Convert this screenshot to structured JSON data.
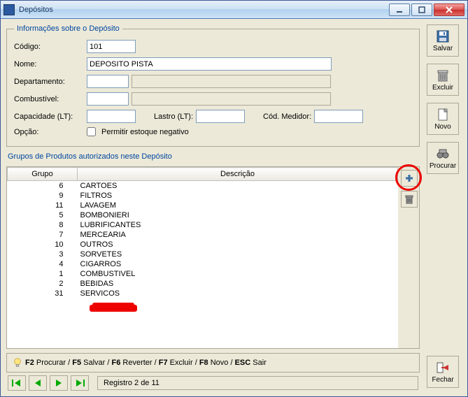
{
  "window": {
    "title": "Depósitos"
  },
  "info": {
    "legend": "Informações sobre o Depósito",
    "codigo_label": "Código:",
    "codigo_value": "101",
    "nome_label": "Nome:",
    "nome_value": "DEPOSITO PISTA",
    "dep_label": "Departamento:",
    "comb_label": "Combustível:",
    "cap_label": "Capacidade (LT):",
    "lastro_label": "Lastro (LT):",
    "medidor_label": "Cód. Medidor:",
    "opcao_label": "Opção:",
    "permitir_label": "Permitir estoque negativo"
  },
  "groups": {
    "title": "Grupos de Produtos autorizados neste Depósito",
    "col_grupo": "Grupo",
    "col_desc": "Descrição",
    "rows": [
      {
        "g": "6",
        "d": "CARTOES"
      },
      {
        "g": "9",
        "d": "FILTROS"
      },
      {
        "g": "11",
        "d": "LAVAGEM"
      },
      {
        "g": "5",
        "d": "BOMBONIERI"
      },
      {
        "g": "8",
        "d": "LUBRIFICANTES"
      },
      {
        "g": "7",
        "d": "MERCEARIA"
      },
      {
        "g": "10",
        "d": "OUTROS"
      },
      {
        "g": "3",
        "d": "SORVETES"
      },
      {
        "g": "4",
        "d": "CIGARROS"
      },
      {
        "g": "1",
        "d": "COMBUSTIVEL"
      },
      {
        "g": "2",
        "d": "BEBIDAS"
      },
      {
        "g": "31",
        "d": "SERVICOS"
      }
    ]
  },
  "side": {
    "salvar": "Salvar",
    "excluir": "Excluir",
    "novo": "Novo",
    "procurar": "Procurar",
    "fechar": "Fechar"
  },
  "status": {
    "f2": "F2",
    "f2t": " Procurar / ",
    "f5": "F5",
    "f5t": " Salvar / ",
    "f6": "F6",
    "f6t": " Reverter / ",
    "f7": "F7",
    "f7t": " Excluir / ",
    "f8": "F8",
    "f8t": " Novo / ",
    "esc": "ESC",
    "esct": " Sair"
  },
  "nav": {
    "record": "Registro 2 de 11"
  }
}
